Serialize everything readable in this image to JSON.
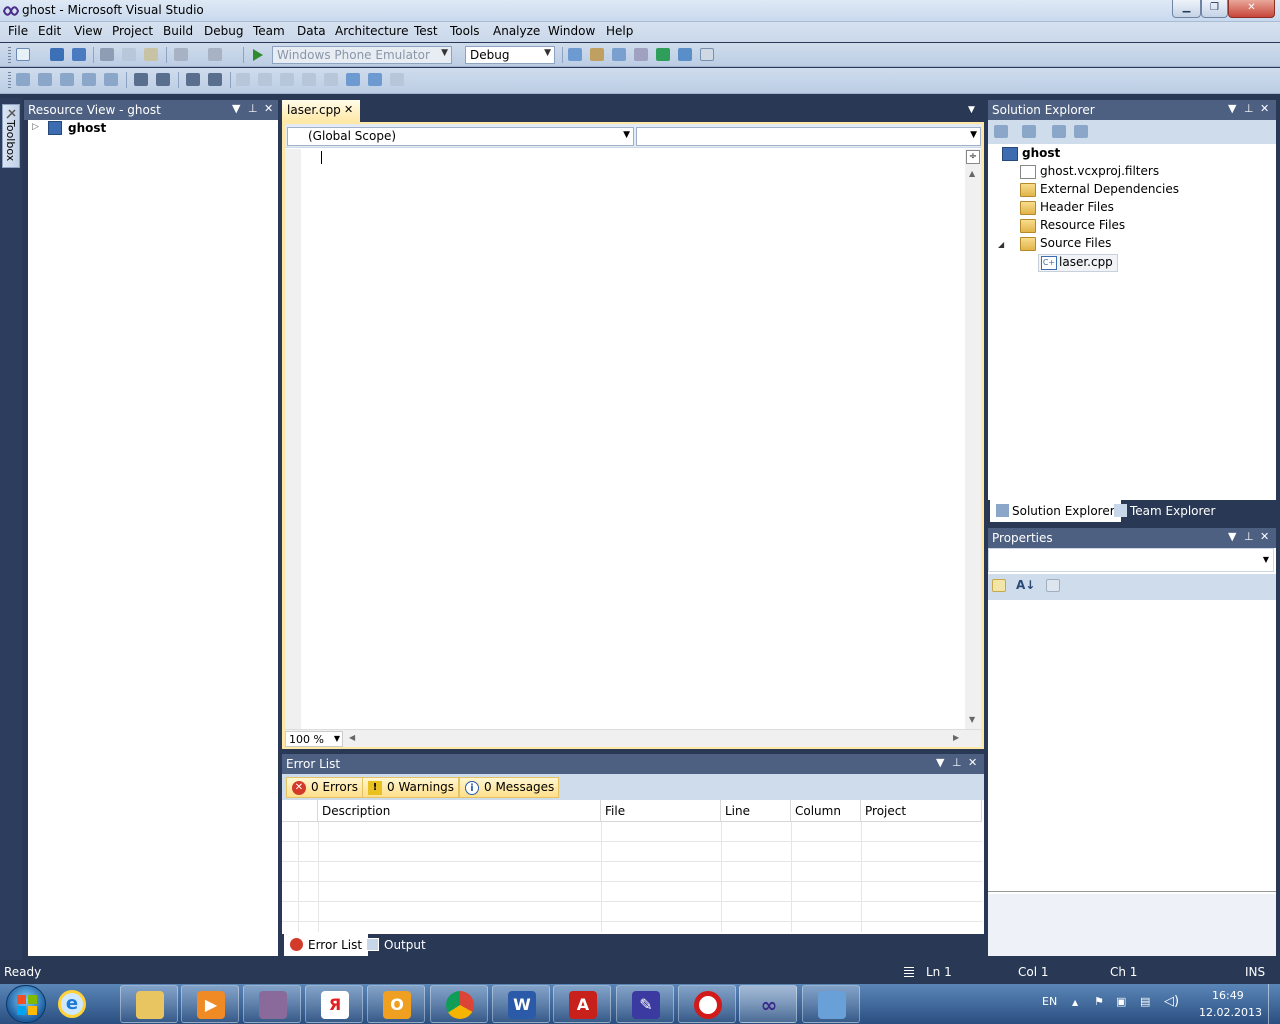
{
  "window": {
    "title": "ghost - Microsoft Visual Studio",
    "minimize": "▁",
    "maximize": "❐",
    "close": "✕"
  },
  "menu": [
    "File",
    "Edit",
    "View",
    "Project",
    "Build",
    "Debug",
    "Team",
    "Data",
    "Architecture",
    "Test",
    "Tools",
    "Analyze",
    "Window",
    "Help"
  ],
  "toolbar": {
    "platform_target": "Windows Phone Emulator",
    "configuration": "Debug"
  },
  "toolbox": {
    "label": "Toolbox"
  },
  "resource_view": {
    "title": "Resource View - ghost",
    "root": "ghost"
  },
  "editor": {
    "tab": "laser.cpp",
    "scope": "(Global Scope)",
    "member": "",
    "zoom": "100 %"
  },
  "error_list": {
    "title": "Error List",
    "errors_btn": "0 Errors",
    "warnings_btn": "0 Warnings",
    "messages_btn": "0 Messages",
    "columns": [
      "Description",
      "File",
      "Line",
      "Column",
      "Project"
    ],
    "tabs": [
      "Error List",
      "Output"
    ]
  },
  "solution_explorer": {
    "title": "Solution Explorer",
    "root": "ghost",
    "items": [
      "ghost.vcxproj.filters",
      "External Dependencies",
      "Header Files",
      "Resource Files",
      "Source Files"
    ],
    "source_child": "laser.cpp",
    "tabs": [
      "Solution Explorer",
      "Team Explorer"
    ]
  },
  "properties": {
    "title": "Properties"
  },
  "status": {
    "text": "Ready",
    "ln": "Ln 1",
    "col": "Col 1",
    "ch": "Ch 1",
    "mode": "INS"
  },
  "tray": {
    "lang": "EN",
    "time": "16:49",
    "date": "12.02.2013"
  },
  "colors": {
    "accent_tab": "#ffe8a6",
    "panel_header": "#4d6082",
    "background": "#293955"
  },
  "icons": {
    "taskbar_apps": [
      "internet-explorer",
      "file-explorer",
      "media-player",
      "archiver",
      "yandex-browser",
      "outlook",
      "chrome",
      "word",
      "acrobat",
      "editor",
      "opera",
      "visual-studio",
      "remote-desktop"
    ]
  }
}
